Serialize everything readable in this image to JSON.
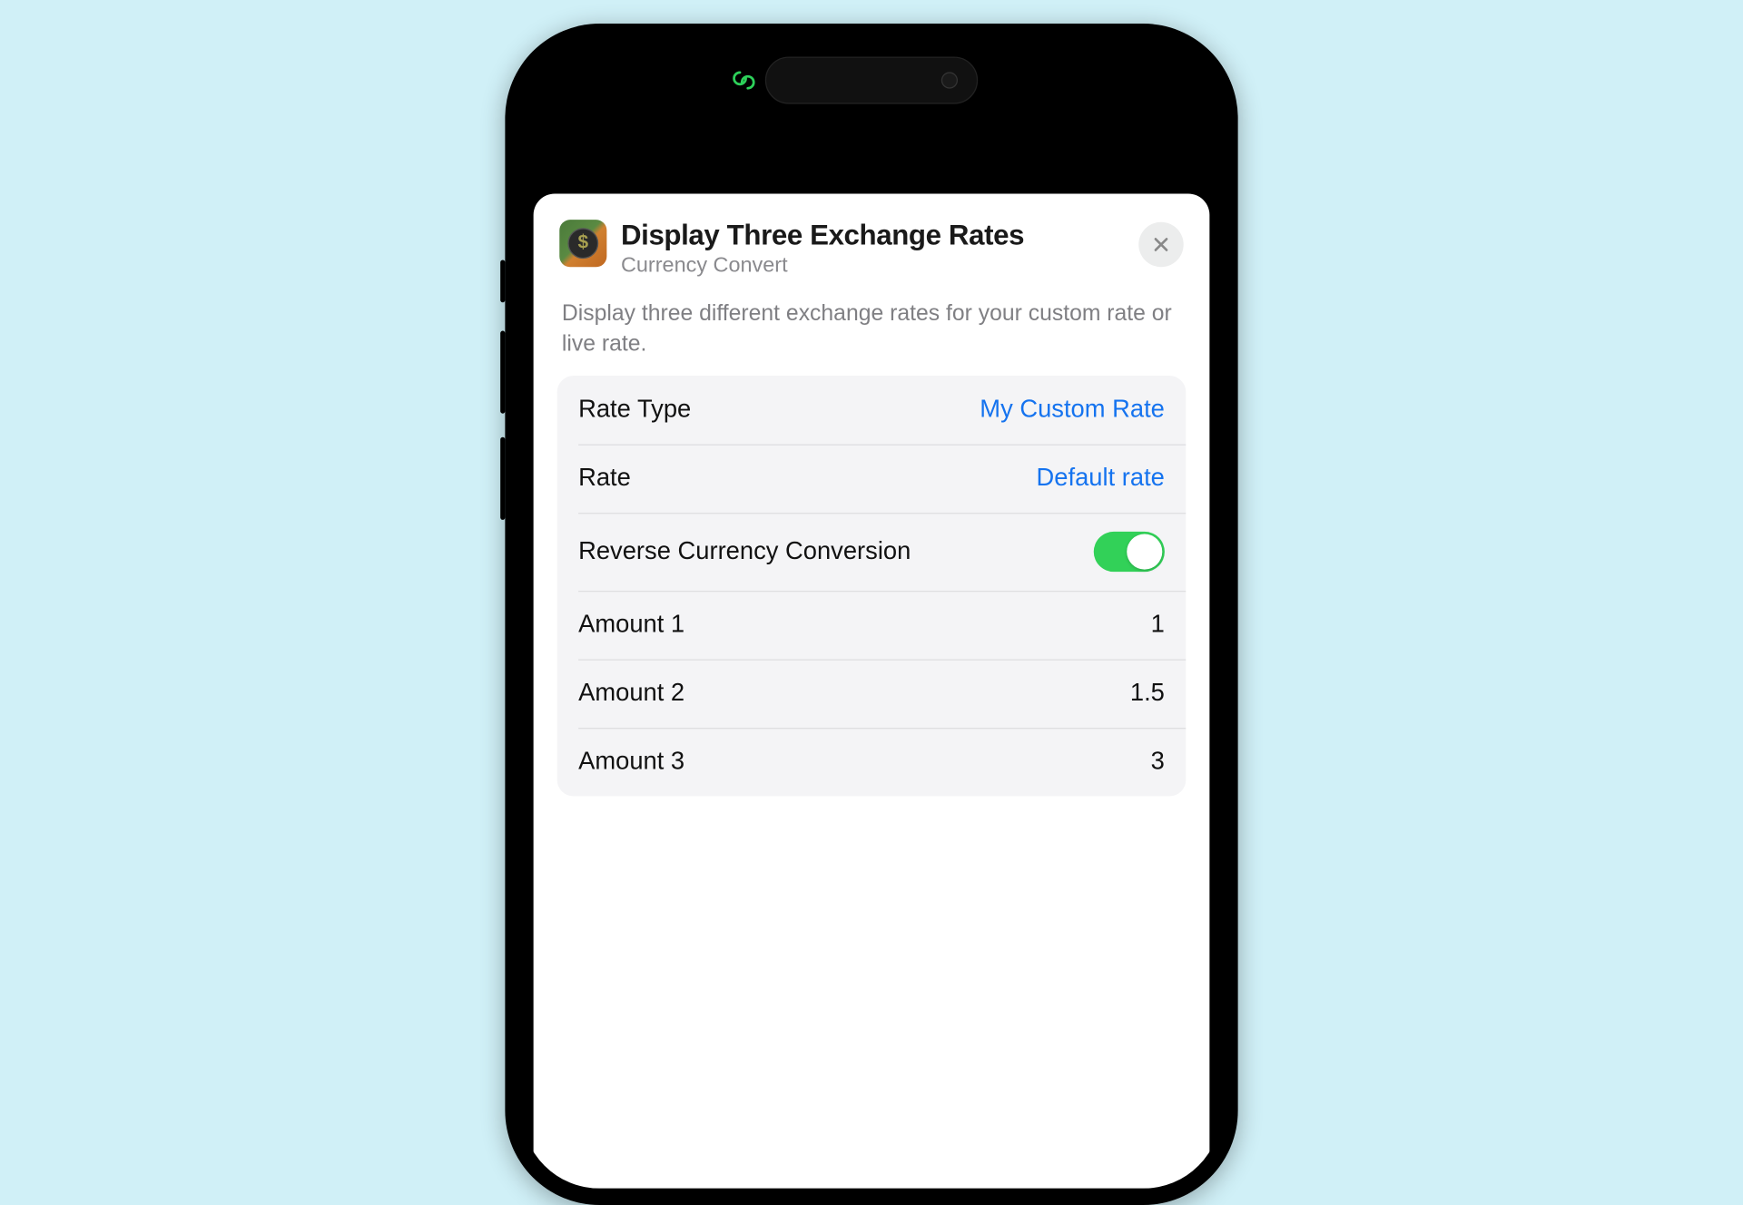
{
  "header": {
    "title": "Display Three Exchange Rates",
    "subtitle": "Currency Convert"
  },
  "description": "Display three different exchange rates for your custom rate or live rate.",
  "settings": {
    "rateType": {
      "label": "Rate Type",
      "value": "My Custom Rate"
    },
    "rate": {
      "label": "Rate",
      "value": "Default rate"
    },
    "reverse": {
      "label": "Reverse Currency Conversion",
      "on": true
    },
    "amounts": [
      {
        "label": "Amount 1",
        "value": "1"
      },
      {
        "label": "Amount 2",
        "value": "1.5"
      },
      {
        "label": "Amount 3",
        "value": "3"
      }
    ]
  }
}
